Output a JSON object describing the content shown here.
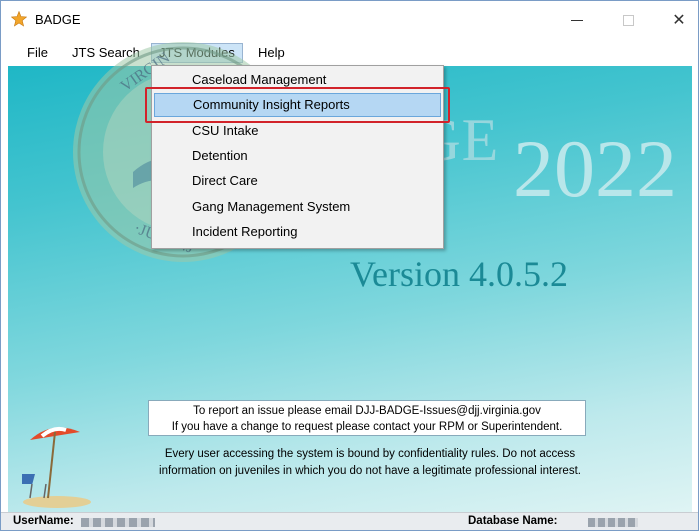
{
  "window": {
    "title": "BADGE"
  },
  "menu": {
    "file": "File",
    "jts_search": "JTS Search",
    "jts_modules": "JTS Modules",
    "help": "Help"
  },
  "dropdown": {
    "items": [
      "Caseload Management",
      "Community Insight Reports",
      "CSU Intake",
      "Detention",
      "Direct Care",
      "Gang Management System",
      "Incident Reporting"
    ],
    "highlighted_index": 1
  },
  "splash": {
    "logo_word": "DGE",
    "logo_year": "2022",
    "version": "Version 4.0.5.2",
    "report_line1": "To report an issue please email DJJ-BADGE-Issues@djj.virginia.gov",
    "report_line2": "If you have a change to request please contact your RPM or Superintendent.",
    "notice_line1": "Every user accessing the system is bound by confidentiality rules. Do not access",
    "notice_line2": "information on juveniles in which you do not have a legitimate professional interest."
  },
  "status": {
    "username_label": "UserName:",
    "database_label": "Database Name:"
  },
  "colors": {
    "accent": "#1fb7c6",
    "version_text": "#1b8a96",
    "highlight": "#b5d7f3",
    "annotation_red": "#d2232a"
  }
}
